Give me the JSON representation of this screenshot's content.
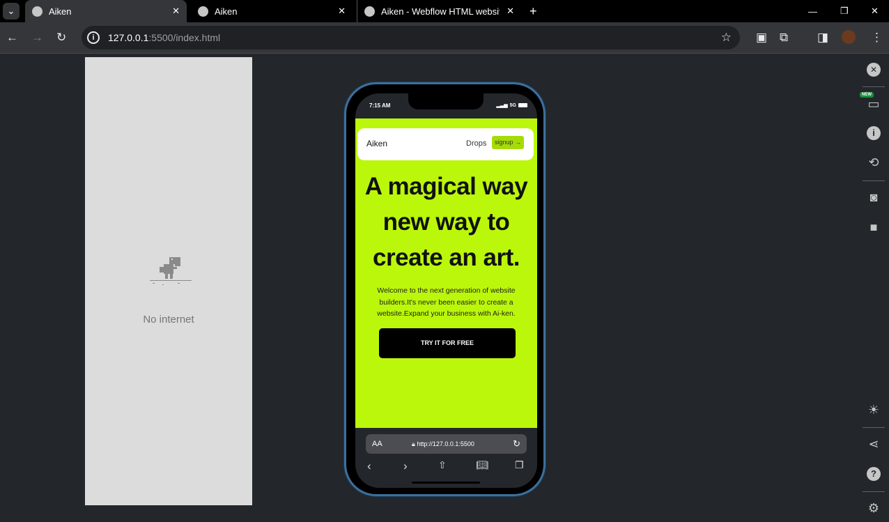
{
  "tabs": [
    {
      "title": "Aiken",
      "active": true
    },
    {
      "title": "Aiken",
      "active": false
    },
    {
      "title": "Aiken - Webflow HTML website",
      "active": false
    }
  ],
  "address": {
    "host": "127.0.0.1",
    "path": ":5500/index.html"
  },
  "offline": {
    "message": "No internet"
  },
  "phone": {
    "status": {
      "time": "7:15 AM",
      "network": "5G"
    },
    "site": {
      "brand": "Aiken",
      "nav_link": "Drops",
      "signup": "signup →",
      "headline_lines": [
        "A magical way",
        "new way to",
        "create an art."
      ],
      "subtitle": "Welcome to the next generation of website builders.It's never been easier to create a website.Expand your business with Ai-ken.",
      "cta": "TRY IT FOR FREE"
    },
    "safari": {
      "aa": "AA",
      "url": "http://127.0.0.1:5500"
    }
  },
  "sidebar": {
    "new_badge": "NEW"
  },
  "colors": {
    "accent": "#bbf70a",
    "frame": "#3d6f9c"
  }
}
